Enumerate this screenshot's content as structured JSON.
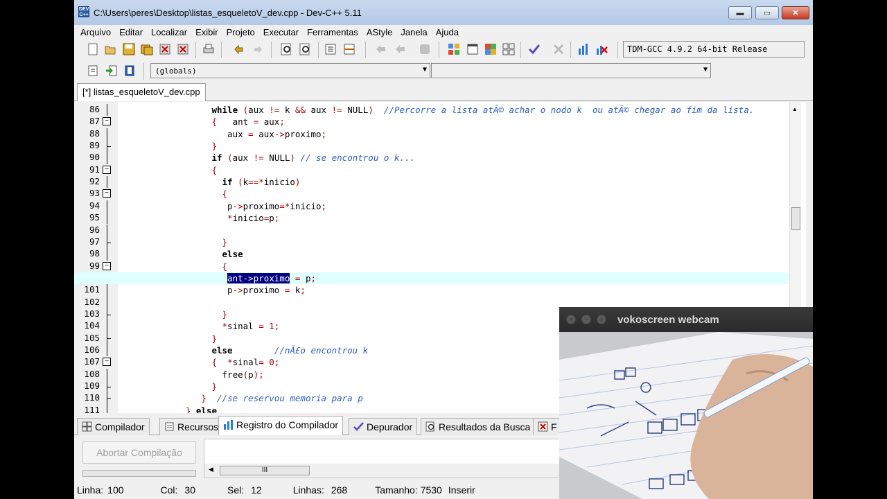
{
  "window": {
    "title": "C:\\Users\\peres\\Desktop\\listas_esqueletoV_dev.cpp - Dev-C++ 5.11",
    "min": "▬",
    "max": "▭",
    "close": "✕"
  },
  "menu": [
    "Arquivo",
    "Editar",
    "Localizar",
    "Exibir",
    "Projeto",
    "Executar",
    "Ferramentas",
    "AStyle",
    "Janela",
    "Ajuda"
  ],
  "toolbar": {
    "compiler": "TDM-GCC 4.9.2 64-bit Release",
    "globals_combo": "(globals)",
    "second_combo": ""
  },
  "file_tab": "[*] listas_esqueletoV_dev.cpp",
  "editor": {
    "lines": [
      {
        "n": "86",
        "tokens": [
          [
            "",
            "                  "
          ],
          [
            "kw",
            "while"
          ],
          [
            "",
            " "
          ],
          [
            "sy",
            "("
          ],
          [
            "",
            "aux "
          ],
          [
            "sy",
            "!="
          ],
          [
            "",
            " k "
          ],
          [
            "sy",
            "&&"
          ],
          [
            "",
            " aux "
          ],
          [
            "sy",
            "!="
          ],
          [
            "",
            " NULL"
          ],
          [
            "sy",
            ")"
          ],
          [
            "",
            "  "
          ],
          [
            "cm",
            "//Percorre a lista atÃ© achar o nodo k  ou atÃ© chegar ao fim da lista."
          ]
        ]
      },
      {
        "n": "87",
        "tokens": [
          [
            "",
            "                  "
          ],
          [
            "sy",
            "{"
          ],
          [
            "",
            "   ant "
          ],
          [
            "sy",
            "="
          ],
          [
            "",
            " aux"
          ],
          [
            "sy",
            ";"
          ]
        ]
      },
      {
        "n": "88",
        "tokens": [
          [
            "",
            "                     aux "
          ],
          [
            "sy",
            "="
          ],
          [
            "",
            " aux"
          ],
          [
            "sy",
            "->"
          ],
          [
            "",
            "proximo"
          ],
          [
            "sy",
            ";"
          ]
        ]
      },
      {
        "n": "89",
        "tokens": [
          [
            "",
            "                  "
          ],
          [
            "sy",
            "}"
          ]
        ]
      },
      {
        "n": "90",
        "tokens": [
          [
            "",
            "                  "
          ],
          [
            "kw",
            "if"
          ],
          [
            "",
            " "
          ],
          [
            "sy",
            "("
          ],
          [
            "",
            "aux "
          ],
          [
            "sy",
            "!="
          ],
          [
            "",
            " NULL"
          ],
          [
            "sy",
            ")"
          ],
          [
            "",
            " "
          ],
          [
            "cm",
            "// se encontrou o k..."
          ]
        ]
      },
      {
        "n": "91",
        "tokens": [
          [
            "",
            "                  "
          ],
          [
            "sy",
            "{"
          ]
        ]
      },
      {
        "n": "92",
        "tokens": [
          [
            "",
            "                    "
          ],
          [
            "kw",
            "if"
          ],
          [
            "",
            " "
          ],
          [
            "sy",
            "("
          ],
          [
            "",
            "k"
          ],
          [
            "sy",
            "==*"
          ],
          [
            "",
            "inicio"
          ],
          [
            "sy",
            ")"
          ]
        ]
      },
      {
        "n": "93",
        "tokens": [
          [
            "",
            "                    "
          ],
          [
            "sy",
            "{"
          ]
        ]
      },
      {
        "n": "94",
        "tokens": [
          [
            "",
            "                     p"
          ],
          [
            "sy",
            "->"
          ],
          [
            "",
            "proximo"
          ],
          [
            "sy",
            "=*"
          ],
          [
            "",
            "inicio"
          ],
          [
            "sy",
            ";"
          ]
        ]
      },
      {
        "n": "95",
        "tokens": [
          [
            "",
            "                     "
          ],
          [
            "sy",
            "*"
          ],
          [
            "",
            "inicio"
          ],
          [
            "sy",
            "="
          ],
          [
            "",
            "p"
          ],
          [
            "sy",
            ";"
          ]
        ]
      },
      {
        "n": "96",
        "tokens": []
      },
      {
        "n": "97",
        "tokens": [
          [
            "",
            "                    "
          ],
          [
            "sy",
            "}"
          ]
        ]
      },
      {
        "n": "98",
        "tokens": [
          [
            "",
            "                    "
          ],
          [
            "kw",
            "else"
          ]
        ]
      },
      {
        "n": "99",
        "tokens": [
          [
            "",
            "                    "
          ],
          [
            "sy",
            "{"
          ]
        ]
      },
      {
        "n": "100",
        "tokens": [
          [
            "",
            "                     "
          ],
          [
            "sel",
            "ant->proximo"
          ],
          [
            "",
            " "
          ],
          [
            "sy",
            "="
          ],
          [
            "",
            " p"
          ],
          [
            "sy",
            ";"
          ]
        ],
        "current": true
      },
      {
        "n": "101",
        "tokens": [
          [
            "",
            "                     p"
          ],
          [
            "sy",
            "->"
          ],
          [
            "",
            "proximo "
          ],
          [
            "sy",
            "="
          ],
          [
            "",
            " k"
          ],
          [
            "sy",
            ";"
          ]
        ]
      },
      {
        "n": "102",
        "tokens": []
      },
      {
        "n": "103",
        "tokens": [
          [
            "",
            "                    "
          ],
          [
            "sy",
            "}"
          ]
        ]
      },
      {
        "n": "104",
        "tokens": [
          [
            "",
            "                    "
          ],
          [
            "sy",
            "*"
          ],
          [
            "",
            "sinal "
          ],
          [
            "sy",
            "="
          ],
          [
            "",
            " "
          ],
          [
            "nm",
            "1"
          ],
          [
            "sy",
            ";"
          ]
        ]
      },
      {
        "n": "105",
        "tokens": [
          [
            "",
            "                  "
          ],
          [
            "sy",
            "}"
          ]
        ]
      },
      {
        "n": "106",
        "tokens": [
          [
            "",
            "                  "
          ],
          [
            "kw",
            "else"
          ],
          [
            "",
            "        "
          ],
          [
            "cm",
            "//nÃ£o encontrou k"
          ]
        ]
      },
      {
        "n": "107",
        "tokens": [
          [
            "",
            "                  "
          ],
          [
            "sy",
            "{"
          ],
          [
            "",
            "  "
          ],
          [
            "sy",
            "*"
          ],
          [
            "",
            "sinal"
          ],
          [
            "sy",
            "="
          ],
          [
            "",
            " "
          ],
          [
            "nm",
            "0"
          ],
          [
            "sy",
            ";"
          ]
        ]
      },
      {
        "n": "108",
        "tokens": [
          [
            "",
            "                    free"
          ],
          [
            "sy",
            "("
          ],
          [
            "",
            "p"
          ],
          [
            "sy",
            ")"
          ],
          [
            "sy",
            ";"
          ]
        ]
      },
      {
        "n": "109",
        "tokens": [
          [
            "",
            "                  "
          ],
          [
            "sy",
            "}"
          ]
        ]
      },
      {
        "n": "110",
        "tokens": [
          [
            "",
            "                "
          ],
          [
            "sy",
            "}"
          ],
          [
            "",
            "  "
          ],
          [
            "cm",
            "//se reservou memoria para p"
          ]
        ]
      },
      {
        "n": "111",
        "tokens": [
          [
            "",
            "             "
          ],
          [
            "sy",
            "}"
          ],
          [
            "",
            " "
          ],
          [
            "kw",
            "else"
          ]
        ]
      }
    ]
  },
  "bottom_tabs": [
    {
      "label": "Compilador",
      "icon": "grid-icon"
    },
    {
      "label": "Recursos",
      "icon": "resources-icon"
    },
    {
      "label": "Registro do Compilador",
      "icon": "chart-icon",
      "active": true
    },
    {
      "label": "Depurador",
      "icon": "check-icon"
    },
    {
      "label": "Resultados da Busca",
      "icon": "search-icon"
    },
    {
      "label": "F",
      "icon": "close-icon"
    }
  ],
  "bottom_panel": {
    "abort_label": "Abortar Compilação",
    "hscroll_label": "III"
  },
  "status": {
    "linha_label": "Linha:",
    "linha": "100",
    "col_label": "Col:",
    "col": "30",
    "sel_label": "Sel:",
    "sel": "12",
    "linhas_label": "Linhas:",
    "linhas": "268",
    "tamanho_label": "Tamanho:",
    "tamanho": "7530",
    "mode": "Inserir"
  },
  "webcam": {
    "title": "vokoscreen webcam"
  }
}
